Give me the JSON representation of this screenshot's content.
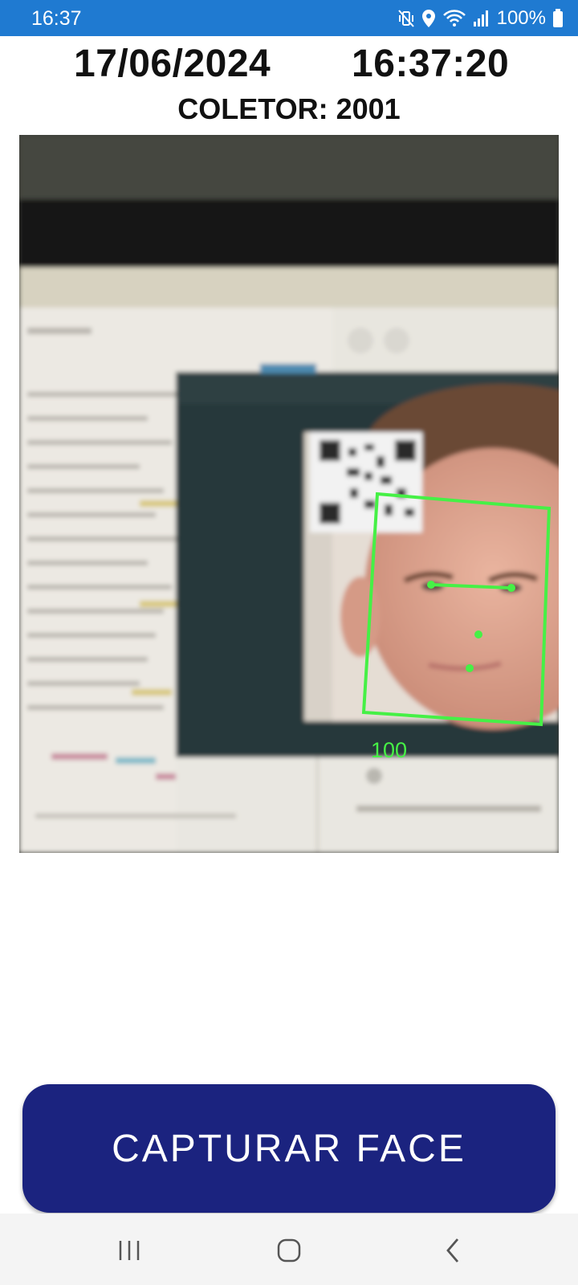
{
  "status_bar": {
    "time": "16:37",
    "battery": "100%",
    "icons": [
      "mute-vibrate-icon",
      "location-icon",
      "wifi-icon",
      "signal-icon",
      "battery-icon"
    ]
  },
  "header": {
    "date": "17/06/2024",
    "time": "16:37:20",
    "coletor": "COLETOR: 2001"
  },
  "camera": {
    "face_score": "100",
    "overlay_color": "#46f046"
  },
  "actions": {
    "capture_label": "CAPTURAR FACE",
    "button_color": "#1b237f"
  },
  "nav": {
    "icons": [
      "recent-apps-icon",
      "home-icon",
      "back-icon"
    ]
  }
}
